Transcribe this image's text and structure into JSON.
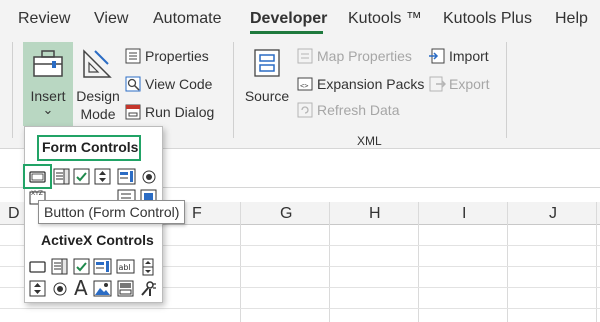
{
  "ribbon_tabs": [
    "Review",
    "View",
    "Automate",
    "Developer",
    "Kutools ™",
    "Kutools Plus",
    "Help"
  ],
  "active_tab": "Developer",
  "controls_group": {
    "insert_label": "Insert",
    "insert_chevron": "⌄",
    "design_mode_label_1": "Design",
    "design_mode_label_2": "Mode",
    "properties_label": "Properties",
    "view_code_label": "View Code",
    "run_dialog_label": "Run Dialog"
  },
  "xml_group": {
    "source_label": "Source",
    "map_properties_label": "Map Properties",
    "expansion_packs_label": "Expansion Packs",
    "refresh_data_label": "Refresh Data",
    "import_label": "Import",
    "export_label": "Export",
    "group_label": "XML"
  },
  "insert_menu": {
    "form_controls_heading": "Form Controls",
    "activex_heading": "ActiveX Controls",
    "form_control_icons": [
      "button-icon",
      "combo-box-icon",
      "checkbox-icon",
      "spin-button-icon",
      "list-box-icon",
      "option-button-icon",
      "group-box-icon",
      "label-icon",
      "scroll-bar-icon",
      "text-field-icon",
      "combo-list-edit-icon",
      "combo-drop-down-icon"
    ],
    "activex_icons": [
      "command-button-icon",
      "combo-box-icon",
      "checkbox-icon",
      "list-box-icon",
      "text-box-icon",
      "scroll-bar-icon",
      "spin-button-icon",
      "option-button-icon",
      "label-icon",
      "image-icon",
      "toggle-button-icon",
      "more-controls-icon"
    ]
  },
  "tooltip": "Button (Form Control)",
  "columns": [
    "D",
    "F",
    "G",
    "H",
    "I",
    "J"
  ],
  "colors": {
    "accent": "#1f7a3e",
    "insert_bg": "#b9d7c2",
    "highlight_border": "#21a366"
  }
}
